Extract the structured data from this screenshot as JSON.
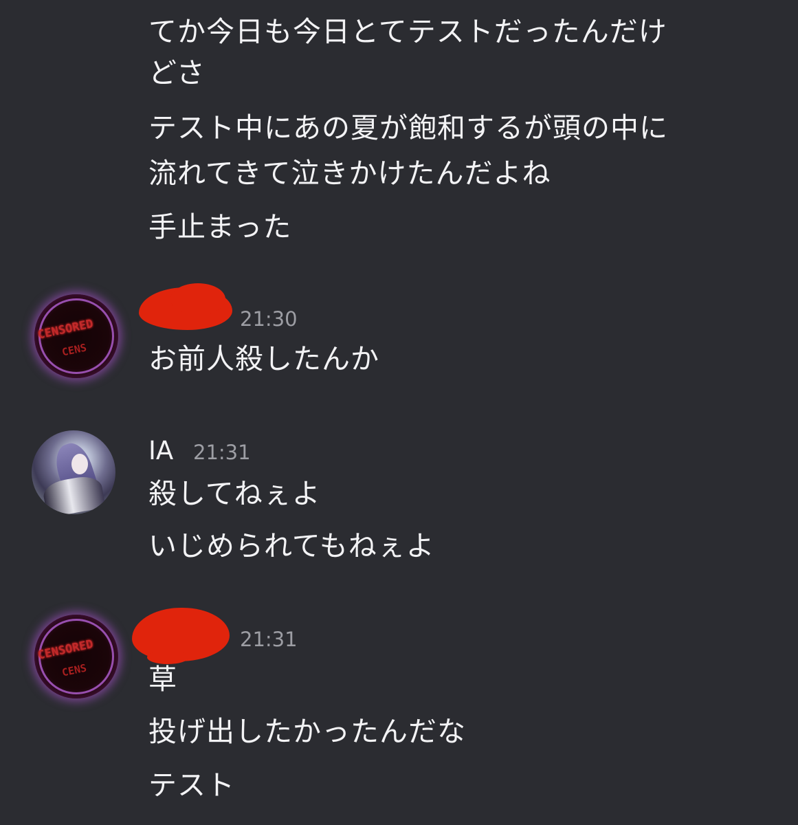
{
  "messages_prev": {
    "line1": "てか今日も今日とてテストだったんだけ",
    "line2": "どさ",
    "line3": "テスト中にあの夏が飽和するが頭の中に",
    "line4": "流れてきて泣きかけたんだよね",
    "line5": "手止まった"
  },
  "group1": {
    "time": "21:30",
    "line1": "お前人殺したんか",
    "avatar_text": "CENSORED",
    "avatar_text2": "CENS"
  },
  "group2": {
    "name": "IA",
    "time": "21:31",
    "line1": "殺してねぇよ",
    "line2": "いじめられてもねぇよ"
  },
  "group3": {
    "time": "21:31",
    "line1": "草",
    "line2": "投げ出したかったんだな",
    "line3": "テスト",
    "avatar_text": "CENSORED",
    "avatar_text2": "CENS"
  },
  "colors": {
    "background": "#2b2c31",
    "text": "#f3f3f5",
    "timestamp": "#9d9ea4",
    "redaction": "#e0240c"
  }
}
